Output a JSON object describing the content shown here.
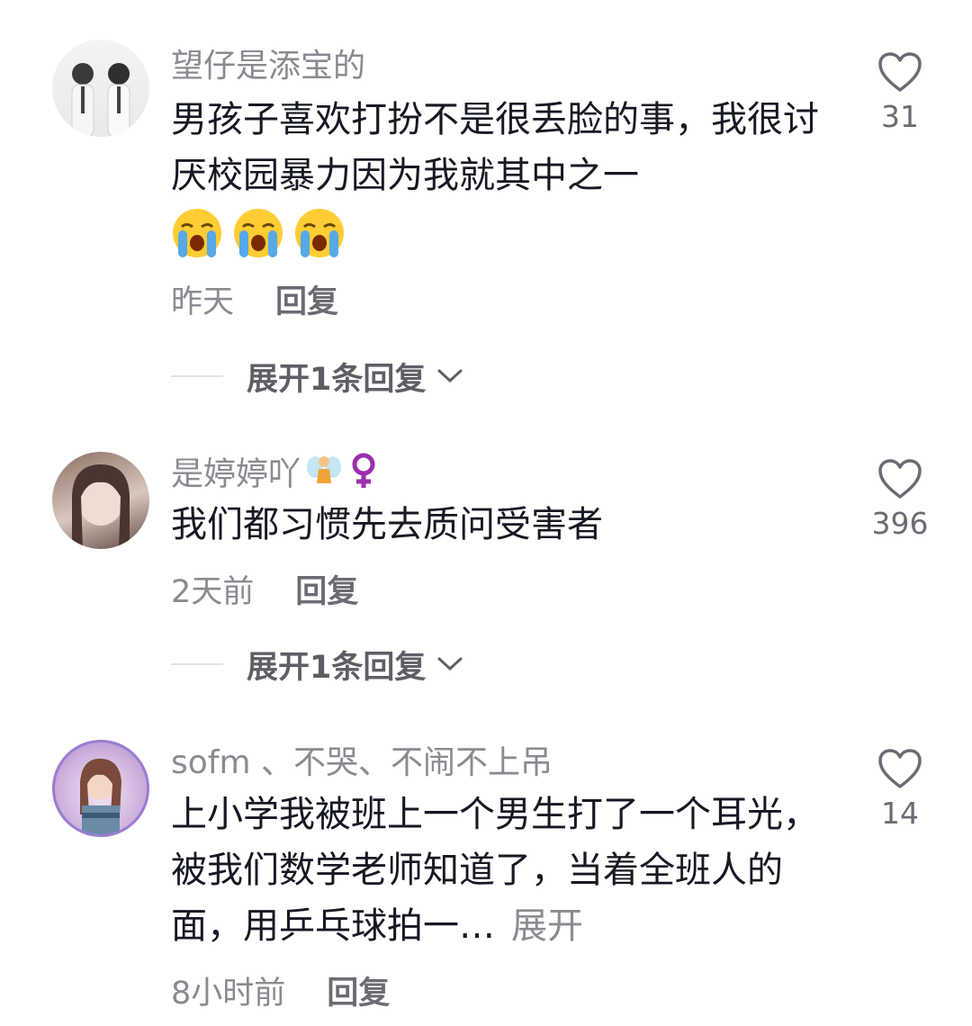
{
  "comments": [
    {
      "username": "望仔是添宝的",
      "text": "男孩子喜欢打扮不是很丢脸的事，我很讨厌校园暴力因为我就其中之一",
      "emojis": [
        "loudly-crying-face",
        "loudly-crying-face",
        "loudly-crying-face"
      ],
      "time": "昨天",
      "reply_label": "回复",
      "likes": "31",
      "expand_replies": "展开1条回复"
    },
    {
      "username": "是婷婷吖",
      "username_badges": [
        "fairy-emoji",
        "female-sign"
      ],
      "text": "我们都习惯先去质问受害者",
      "time": "2天前",
      "reply_label": "回复",
      "likes": "396",
      "expand_replies": "展开1条回复"
    },
    {
      "username": "sofm 、不哭、不闹不上吊",
      "text": "上小学我被班上一个男生打了一个耳光，被我们数学老师知道了，当着全班人的面，用乒乓球拍一…",
      "expand_inline": "展开",
      "time": "8小时前",
      "reply_label": "回复",
      "likes": "14"
    }
  ],
  "colors": {
    "primary_text": "#161823",
    "secondary_text": "#8a8b91",
    "background": "#ffffff"
  }
}
